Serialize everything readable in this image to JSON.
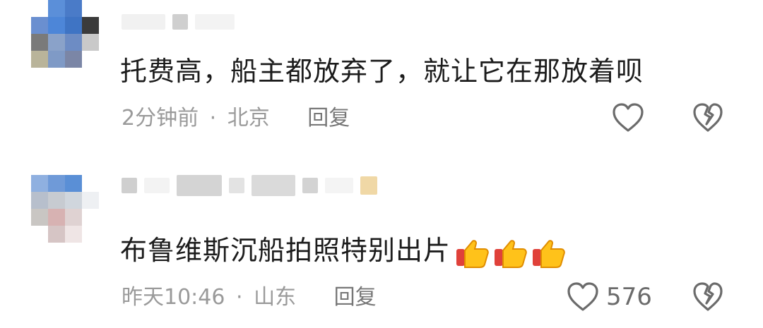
{
  "comments": [
    {
      "text": "托费高，船主都放弃了，就让它在那放着呗",
      "time": "2分钟前",
      "location": "北京",
      "reply_label": "回复",
      "like_count": ""
    },
    {
      "text": "布鲁维斯沉船拍照特别出片",
      "emoji": [
        "thumbs-up",
        "thumbs-up",
        "thumbs-up"
      ],
      "time": "昨天10:46",
      "location": "山东",
      "reply_label": "回复",
      "like_count": "576"
    }
  ],
  "meta_separator": "·",
  "icons": {
    "like": "heart-outline-icon",
    "dislike": "broken-heart-icon",
    "emoji": "thumbs-up-icon"
  },
  "colors": {
    "text": "#1c1c1c",
    "meta": "#9a9a9a",
    "icon": "#6b6b6b"
  }
}
